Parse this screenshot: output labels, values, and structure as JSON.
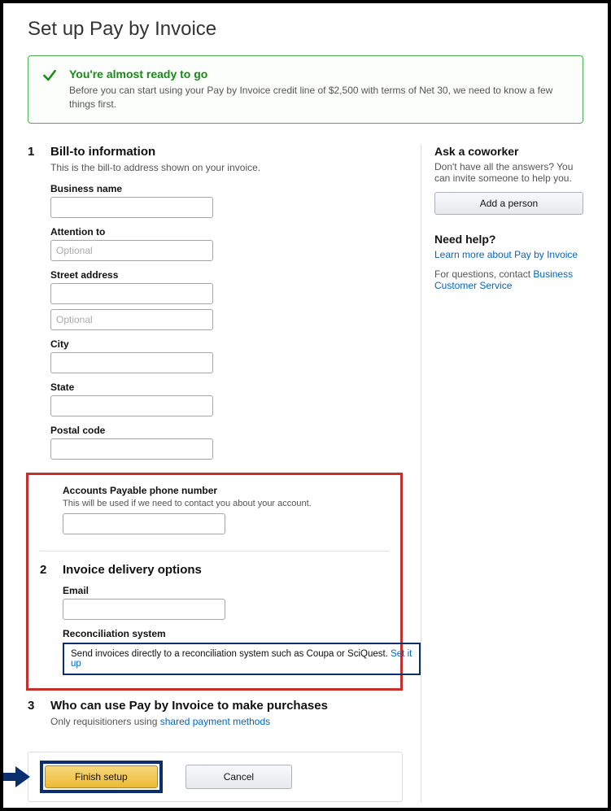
{
  "pageTitle": "Set up Pay by Invoice",
  "alert": {
    "title": "You're almost ready to go",
    "body": "Before you can start using your Pay by Invoice credit line of $2,500 with terms of Net 30, we need to know a few things first."
  },
  "sidebar": {
    "coworker": {
      "heading": "Ask a coworker",
      "desc": "Don't have all the answers? You can invite someone to help you.",
      "button": "Add a person"
    },
    "help": {
      "heading": "Need help?",
      "learnMore": "Learn more about Pay by Invoice",
      "contactPrefix": "For questions, contact ",
      "contactLink": "Business Customer Service"
    }
  },
  "sections": {
    "s1": {
      "num": "1",
      "heading": "Bill-to information",
      "desc": "This is the bill-to address shown on your invoice.",
      "fields": {
        "businessName": {
          "label": "Business name",
          "value": "",
          "placeholder": ""
        },
        "attentionTo": {
          "label": "Attention to",
          "value": "",
          "placeholder": "Optional"
        },
        "street": {
          "label": "Street address",
          "value": "",
          "placeholder": ""
        },
        "street2": {
          "value": "",
          "placeholder": "Optional"
        },
        "city": {
          "label": "City",
          "value": "",
          "placeholder": ""
        },
        "state": {
          "label": "State",
          "value": "",
          "placeholder": ""
        },
        "postal": {
          "label": "Postal code",
          "value": "",
          "placeholder": ""
        }
      },
      "apPhone": {
        "label": "Accounts Payable phone number",
        "sub": "This will be used if we need to contact you about your account.",
        "value": ""
      }
    },
    "s2": {
      "num": "2",
      "heading": "Invoice delivery options",
      "email": {
        "label": "Email",
        "value": ""
      },
      "recon": {
        "label": "Reconciliation system",
        "text": "Send invoices directly to a reconciliation system such as Coupa or SciQuest. ",
        "link": "Set it up"
      }
    },
    "s3": {
      "num": "3",
      "heading": "Who can use Pay by Invoice to make purchases",
      "descPrefix": "Only requisitioners using ",
      "descLink": "shared payment methods"
    }
  },
  "footer": {
    "finish": "Finish setup",
    "cancel": "Cancel"
  }
}
